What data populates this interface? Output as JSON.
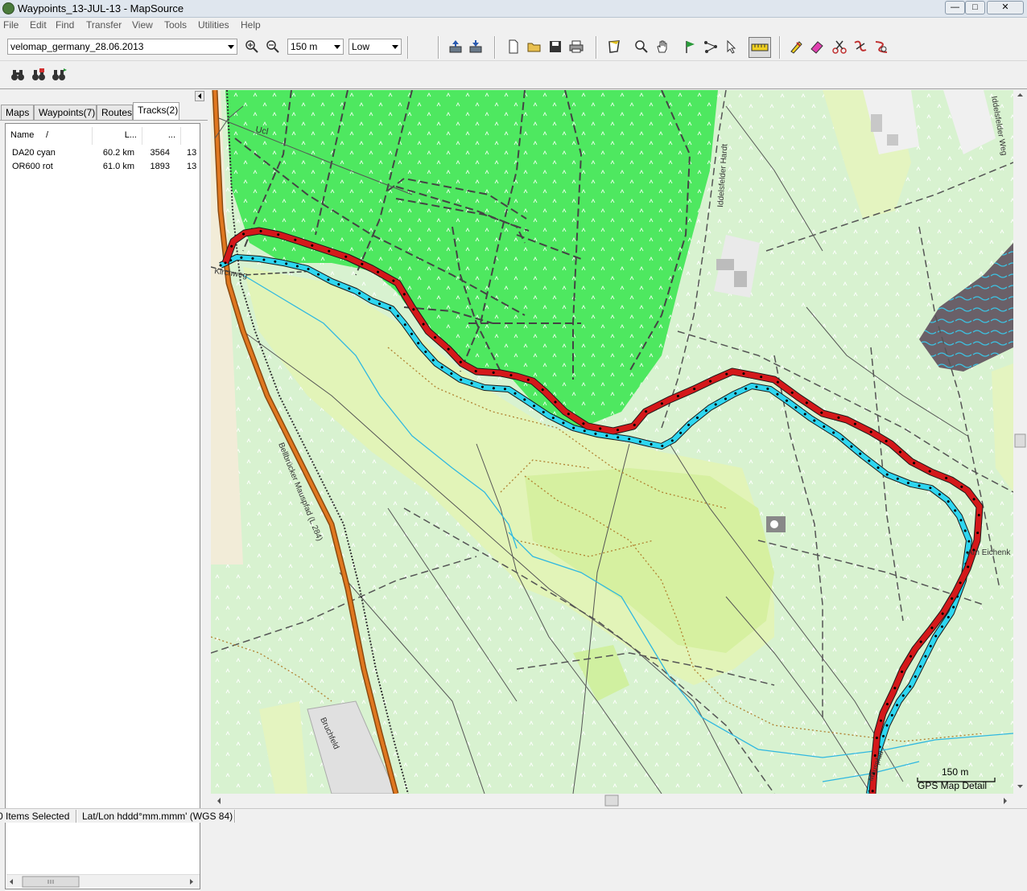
{
  "window": {
    "title": "Waypoints_13-JUL-13 - MapSource"
  },
  "menu": [
    "File",
    "Edit",
    "Find",
    "Transfer",
    "View",
    "Tools",
    "Utilities",
    "Help"
  ],
  "toolbar": {
    "map_product": "velomap_germany_28.06.2013",
    "zoom_level": "150 m",
    "detail_level": "Low"
  },
  "tabs": [
    "Maps",
    "Waypoints(7)",
    "Routes",
    "Tracks(2)"
  ],
  "active_tab": "Tracks(2)",
  "tracks_table": {
    "headers": [
      "Name",
      "L...",
      "..."
    ],
    "sort_indicator": "/",
    "rows": [
      {
        "name": "DA20 cyan",
        "length": "60.2 km",
        "points": "3564",
        "extra": "13"
      },
      {
        "name": "OR600 rot",
        "length": "61.0 km",
        "points": "1893",
        "extra": "13"
      }
    ]
  },
  "map": {
    "labels": {
      "ucl": "Ucl",
      "hardt": "Iddelsfelder Hardt",
      "kirchweg": "Kirchweg",
      "bellbrueck": "Bellbrücker Mauspfad (L 284)",
      "bruchfeld": "Bruchfeld",
      "eichen": "Am Eichenk",
      "mhm": "Mauspfad",
      "idde": "Iddelsfelder Weg"
    },
    "scale_text": "150 m",
    "detail_text": "GPS Map Detail",
    "track_colors": {
      "cyan": "#2dd6f0",
      "red": "#d4181a"
    }
  },
  "status": {
    "selected": "0 Items Selected",
    "coord_format": "Lat/Lon hddd°mm.mmm' (WGS 84)"
  }
}
